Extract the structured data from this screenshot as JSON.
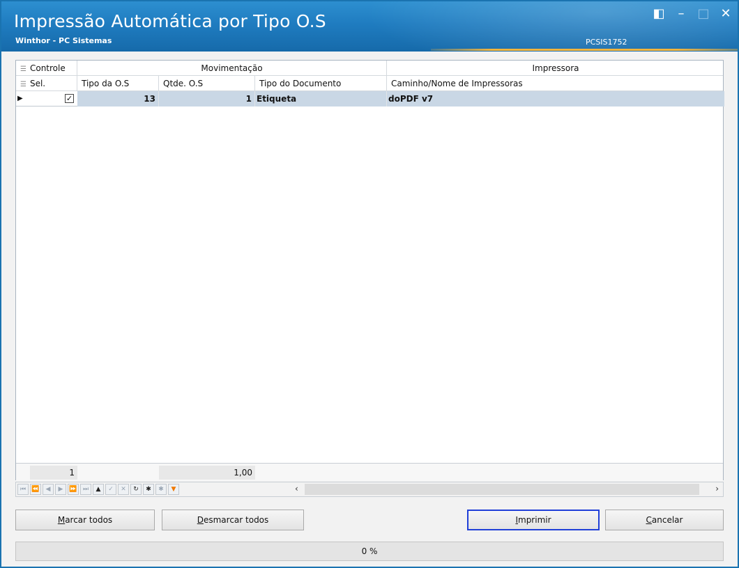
{
  "window": {
    "title": "Impressão Automática por Tipo O.S",
    "subtitle": "Winthor - PC Sistemas",
    "program_code": "PCSIS1752"
  },
  "grid": {
    "group_headers": {
      "controle": "Controle",
      "movimentacao": "Movimentação",
      "impressora": "Impressora"
    },
    "columns": {
      "sel": "Sel.",
      "tipo_os": "Tipo da O.S",
      "qtde_os": "Qtde. O.S",
      "tipo_documento": "Tipo do Documento",
      "caminho": "Caminho/Nome de Impressoras"
    },
    "rows": [
      {
        "selected": true,
        "tipo_os": "13",
        "qtde_os": "1",
        "tipo_documento": "Etiqueta",
        "caminho": "doPDF v7"
      }
    ],
    "footer": {
      "count": "1",
      "sum": "1,00"
    }
  },
  "buttons": {
    "marcar_todos": {
      "accel": "M",
      "rest": "arcar todos"
    },
    "desmarcar_todos": {
      "accel": "D",
      "rest": "esmarcar todos"
    },
    "imprimir": {
      "accel": "I",
      "rest": "mprimir"
    },
    "cancelar": {
      "accel": "C",
      "rest": "ancelar"
    }
  },
  "progress": {
    "label": "0 %",
    "value": 0
  },
  "colors": {
    "titlebar": "#1f7cc0",
    "accent_line": "#f4b43c",
    "selected_row": "#c9d7e5",
    "focus_border": "#1f3fd8"
  }
}
